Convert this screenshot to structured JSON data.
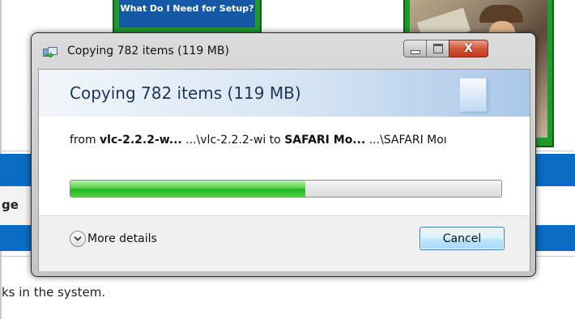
{
  "background": {
    "thumbnail_caption": "What Do I Need for Setup?",
    "row_label": "ge",
    "status_text": "ks in the system."
  },
  "dialog": {
    "title": "Copying 782 items (119 MB)",
    "heading": "Copying 782 items (119 MB)",
    "from_prefix": "from",
    "source_bold": "vlc-2.2.2-w...",
    "source_path": "...\\vlc-2.2.2-wi",
    "to_word": "to",
    "dest_bold": "SAFARI Mo...",
    "dest_path": "...\\SAFARI Moı",
    "progress_fraction": 0.545,
    "more_details_label": "More details",
    "cancel_label": "Cancel",
    "close_glyph": "X",
    "icons": {
      "title": "copy-files-icon",
      "header": "document-icon",
      "details": "chevron-down-icon",
      "minimize": "minimize-icon",
      "maximize": "maximize-icon",
      "close": "close-icon"
    },
    "colors": {
      "progress_fill": "#21b420",
      "header_text": "#1e3553",
      "close_button": "#c2381c"
    }
  }
}
